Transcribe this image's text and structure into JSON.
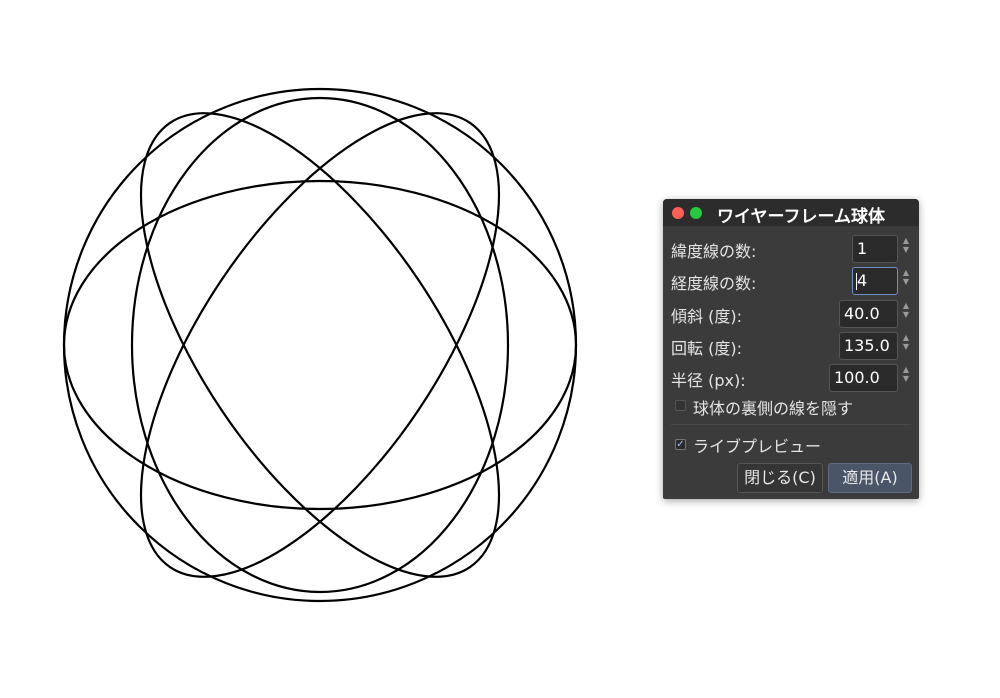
{
  "dialog": {
    "title": "ワイヤーフレーム球体",
    "fields": [
      {
        "label": "緯度線の数:",
        "value": "1"
      },
      {
        "label": "経度線の数:",
        "value": "4"
      },
      {
        "label": "傾斜 (度):",
        "value": "40.0"
      },
      {
        "label": "回転 (度):",
        "value": "135.0"
      },
      {
        "label": "半径 (px):",
        "value": "100.0"
      }
    ],
    "hide_back_lines": {
      "label": "球体の裏側の線を隠す",
      "checked": false
    },
    "live_preview": {
      "label": "ライブプレビュー",
      "checked": true
    },
    "close_button": "閉じる(C)",
    "apply_button": "適用(A)"
  },
  "sphere": {
    "latitude_lines": 1,
    "longitude_lines": 4,
    "tilt_deg": 40.0,
    "rotation_deg": 135.0,
    "radius_px": 100.0,
    "stroke_color": "#000000"
  },
  "colors": {
    "dialog_bg": "#3b3b3b",
    "titlebar_bg": "#2c2c2c",
    "close_dot": "#ff5f57",
    "zoom_dot": "#28c840"
  }
}
